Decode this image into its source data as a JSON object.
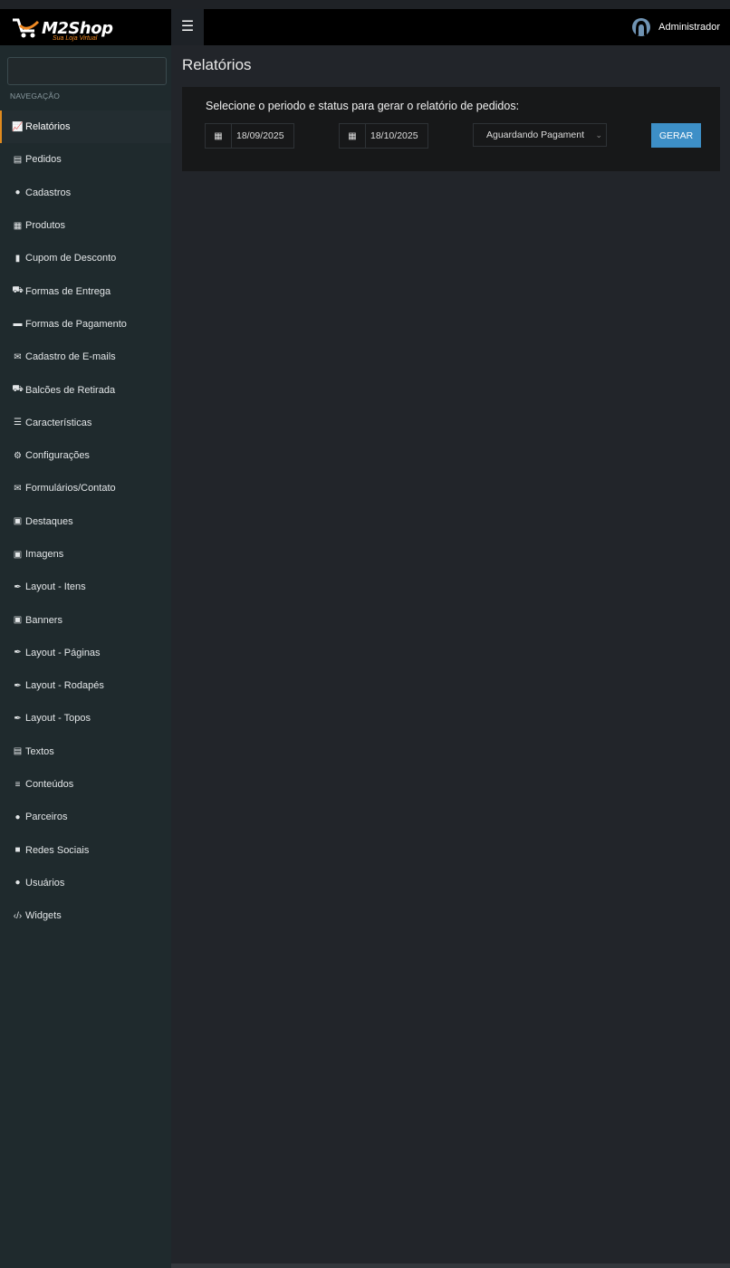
{
  "header": {
    "logo_text": "M2Shop",
    "logo_tagline": "Sua Loja Virtual",
    "toggle_icon": "hamburger-icon",
    "user_icon": "user-avatar-icon",
    "user_name": "Administrador"
  },
  "sidebar": {
    "search_placeholder": "",
    "nav_label": "NAVEGAÇÃO",
    "active_color": "#e08a1e",
    "items": [
      {
        "label": "Relatórios",
        "icon": "chart-icon"
      },
      {
        "label": "Pedidos",
        "icon": "list-alt-icon"
      },
      {
        "label": "Cadastros",
        "icon": "users-icon"
      },
      {
        "label": "Produtos",
        "icon": "cubes-icon"
      },
      {
        "label": "Cupom de Desconto",
        "icon": "barcode-icon"
      },
      {
        "label": "Formas de Entrega",
        "icon": "truck-icon"
      },
      {
        "label": "Formas de Pagamento",
        "icon": "credit-card-icon"
      },
      {
        "label": "Cadastro de E-mails",
        "icon": "envelope-icon"
      },
      {
        "label": " Balcões de Retirada",
        "icon": "truck-icon"
      },
      {
        "label": "Características",
        "icon": "list-icon"
      },
      {
        "label": "Configurações",
        "icon": "cogs-icon"
      },
      {
        "label": "Formulários/Contato",
        "icon": "comments-icon"
      },
      {
        "label": "Destaques",
        "icon": "images-icon"
      },
      {
        "label": "Imagens",
        "icon": "image-icon"
      },
      {
        "label": "Layout - Itens",
        "icon": "brush-icon"
      },
      {
        "label": "Banners",
        "icon": "images-icon"
      },
      {
        "label": "Layout - Páginas",
        "icon": "brush-icon"
      },
      {
        "label": "Layout - Rodapés",
        "icon": "brush-icon"
      },
      {
        "label": "Layout - Topos",
        "icon": "brush-icon"
      },
      {
        "label": "Textos",
        "icon": "file-icon"
      },
      {
        "label": "Conteúdos",
        "icon": "bars-icon"
      },
      {
        "label": "Parceiros",
        "icon": "users-icon"
      },
      {
        "label": "Redes Sociais",
        "icon": "facebook-icon"
      },
      {
        "label": "Usuários",
        "icon": "users-icon"
      },
      {
        "label": "Widgets",
        "icon": "code-icon"
      }
    ]
  },
  "main": {
    "title": "Relatórios",
    "form": {
      "instruction": "Selecione o periodo e status para gerar o relatório de pedidos:",
      "start_date": "18/09/2025",
      "end_date": "18/10/2025",
      "status_selected": "Aguardando Pagament",
      "generate_label": "GERAR",
      "button_color": "#3d8fc7"
    }
  }
}
